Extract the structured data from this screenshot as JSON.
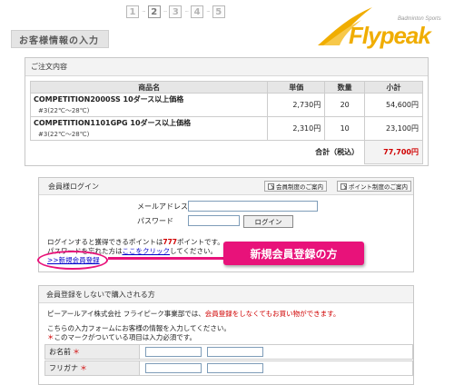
{
  "steps": [
    "1",
    "2",
    "3",
    "4",
    "5"
  ],
  "active_step": "2",
  "page_title": "お客様情報の入力",
  "logo": {
    "text": "Flypeak",
    "tagline": "Badminton Sports",
    "color": "#f0ad00"
  },
  "order": {
    "section_title": "ご注文内容",
    "headers": [
      "商品名",
      "単価",
      "数量",
      "小計"
    ],
    "rows": [
      {
        "name": "COMPETITION2000SS 10ダース以上価格",
        "note": "#3(22℃～28℃)",
        "price": "2,730円",
        "qty": "20",
        "subtotal": "54,600円"
      },
      {
        "name": "COMPETITION1101GPG 10ダース以上価格",
        "note": "#3(22℃～28℃)",
        "price": "2,310円",
        "qty": "10",
        "subtotal": "23,100円"
      }
    ],
    "total_label": "合計（税込）",
    "total_value": "77,700円"
  },
  "login": {
    "section_title": "会員様ログイン",
    "guide_btn_1": "会員制度のご案内",
    "guide_btn_2": "ポイント制度のご案内",
    "email_label": "メールアドレス",
    "password_label": "パスワード",
    "login_button": "ログイン",
    "note_prefix": "ログインすると獲得できるポイントは",
    "note_points": "777",
    "note_suffix": "ポイントです。",
    "forgot_prefix": "パスワードを忘れた方は",
    "forgot_link": "ここをクリック",
    "forgot_suffix": "してください。",
    "register_link": ">>新規会員登録"
  },
  "callout": {
    "text": "新規会員登録の方",
    "color": "#e8127a"
  },
  "guest": {
    "section_title": "会員登録をしないで購入される方",
    "line1_prefix": "ピーアールアイ株式会社 フライピーク事業部では、",
    "line1_red": "会員登録をしなくてもお買い物ができます。",
    "line2": "こちらの入力フォームにお客様の情報を入力してください。",
    "line3_mark": "＊",
    "line3_text": "このマークがついている項目は入力必須です。",
    "fields": [
      {
        "label": "お名前",
        "required_mark": "＊"
      },
      {
        "label": "フリガナ",
        "required_mark": "＊"
      }
    ]
  }
}
